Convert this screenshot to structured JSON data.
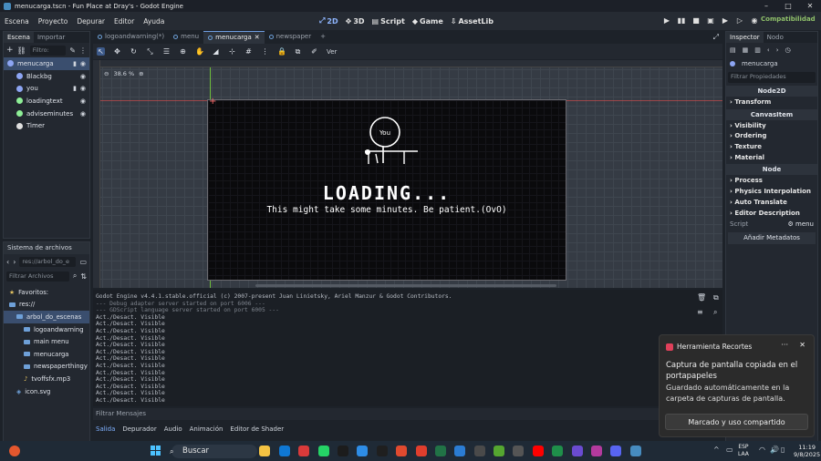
{
  "window": {
    "title": "menucarga.tscn - Fun Place at Dray's - Godot Engine"
  },
  "menu": [
    "Escena",
    "Proyecto",
    "Depurar",
    "Editor",
    "Ayuda"
  ],
  "workspaces": [
    {
      "icon": "2d-icon",
      "label": "2D"
    },
    {
      "icon": "3d-icon",
      "label": "3D"
    },
    {
      "icon": "script-icon",
      "label": "Script"
    },
    {
      "icon": "game-icon",
      "label": "Game"
    },
    {
      "icon": "assetlib-icon",
      "label": "AssetLib"
    }
  ],
  "renderer": "Compatibilidad",
  "scene_dock": {
    "tabs": [
      "Escena",
      "Importar"
    ],
    "filter_placeholder": "Filtro:",
    "nodes": [
      {
        "name": "menucarga",
        "color": "#8da5f3"
      },
      {
        "name": "Blackbg",
        "color": "#8da5f3"
      },
      {
        "name": "you",
        "color": "#8da5f3"
      },
      {
        "name": "loadingtext",
        "color": "#8eef97"
      },
      {
        "name": "adviseminutes",
        "color": "#8eef97"
      },
      {
        "name": "Timer",
        "color": "#e0e0e0"
      }
    ]
  },
  "fs_dock": {
    "title": "Sistema de archivos",
    "path": "res://arbol_do_e",
    "filter_placeholder": "Filtrar Archivos",
    "items": [
      {
        "label": "Favoritos:",
        "indent": 0
      },
      {
        "label": "res://",
        "indent": 0
      },
      {
        "label": "arbol_do_escenas",
        "indent": 1
      },
      {
        "label": "logoandwarning",
        "indent": 2
      },
      {
        "label": "main menu",
        "indent": 2
      },
      {
        "label": "menucarga",
        "indent": 2
      },
      {
        "label": "newspaperthingy",
        "indent": 2
      },
      {
        "label": "tvoffsfx.mp3",
        "indent": 2
      },
      {
        "label": "icon.svg",
        "indent": 1
      }
    ]
  },
  "scene_tabs": [
    "logoandwarning(*)",
    "menu",
    "menucarga",
    "newspaper"
  ],
  "viewport": {
    "zoom": "38.6 %",
    "loading_text": "LOADING...",
    "patient_text": "This might take some minutes. Be patient.(OvO)",
    "character_label": "You",
    "view_label": "Ver"
  },
  "output": {
    "lines": [
      {
        "text": "Godot Engine v4.4.1.stable.official (c) 2007-present Juan Linietsky, Ariel Manzur & Godot Contributors.",
        "dim": false
      },
      {
        "text": "--- Debug adapter server started on port 6006 ---",
        "dim": true
      },
      {
        "text": "--- GDScript language server started on port 6005 ---",
        "dim": true
      },
      {
        "text": "Act./Desact. Visible",
        "dim": false
      },
      {
        "text": "Act./Desact. Visible",
        "dim": false
      },
      {
        "text": "Act./Desact. Visible",
        "dim": false
      },
      {
        "text": "Act./Desact. Visible",
        "dim": false
      },
      {
        "text": "Act./Desact. Visible",
        "dim": false
      },
      {
        "text": "Act./Desact. Visible",
        "dim": false
      },
      {
        "text": "Act./Desact. Visible",
        "dim": false
      },
      {
        "text": "Act./Desact. Visible",
        "dim": false
      },
      {
        "text": "Act./Desact. Visible",
        "dim": false
      },
      {
        "text": "Act./Desact. Visible",
        "dim": false
      },
      {
        "text": "Act./Desact. Visible",
        "dim": false
      },
      {
        "text": "Act./Desact. Visible",
        "dim": false
      },
      {
        "text": "Act./Desact. Visible",
        "dim": false
      }
    ],
    "filter_placeholder": "Filtrar Mensajes",
    "tabs": [
      "Salida",
      "Depurador",
      "Audio",
      "Animación",
      "Editor de Shader"
    ]
  },
  "inspector": {
    "tabs": [
      "Inspector",
      "Nodo"
    ],
    "node": "menucarga",
    "filter_placeholder": "Filtrar Propiedades",
    "class_node2d": "Node2D",
    "sections_a": [
      "Transform"
    ],
    "class_canvasitem": "CanvasItem",
    "sections_b": [
      "Visibility",
      "Ordering",
      "Texture",
      "Material"
    ],
    "class_node": "Node",
    "sections_c": [
      "Process",
      "Physics Interpolation",
      "Auto Translate",
      "Editor Description"
    ],
    "script_label": "Script",
    "script_value": "menu",
    "add_meta": "Añadir Metadatos"
  },
  "toast": {
    "app": "Herramienta Recortes",
    "line1": "Captura de pantalla copiada en el portapapeles",
    "line2": "Guardado automáticamente en la carpeta de capturas de pantalla.",
    "button": "Marcado y uso compartido"
  },
  "taskbar": {
    "search": "Buscar",
    "lang1": "ESP",
    "lang2": "LAA",
    "time": "11:19",
    "date": "9/8/2025",
    "app_colors": [
      "#2b6fd6",
      "#f4c343",
      "#0f78d4",
      "#d93a3a",
      "#25d366",
      "#1c1c1c",
      "#2e8de6",
      "#1f1f1f",
      "#e04a2f",
      "#e03e2d",
      "#217346",
      "#2b7cd3",
      "#4a4a4a",
      "#55a630",
      "#555",
      "#ff0000",
      "#1f8f4a",
      "#6a4bd1",
      "#b33a9e",
      "#5865f2",
      "#478cbf"
    ]
  }
}
